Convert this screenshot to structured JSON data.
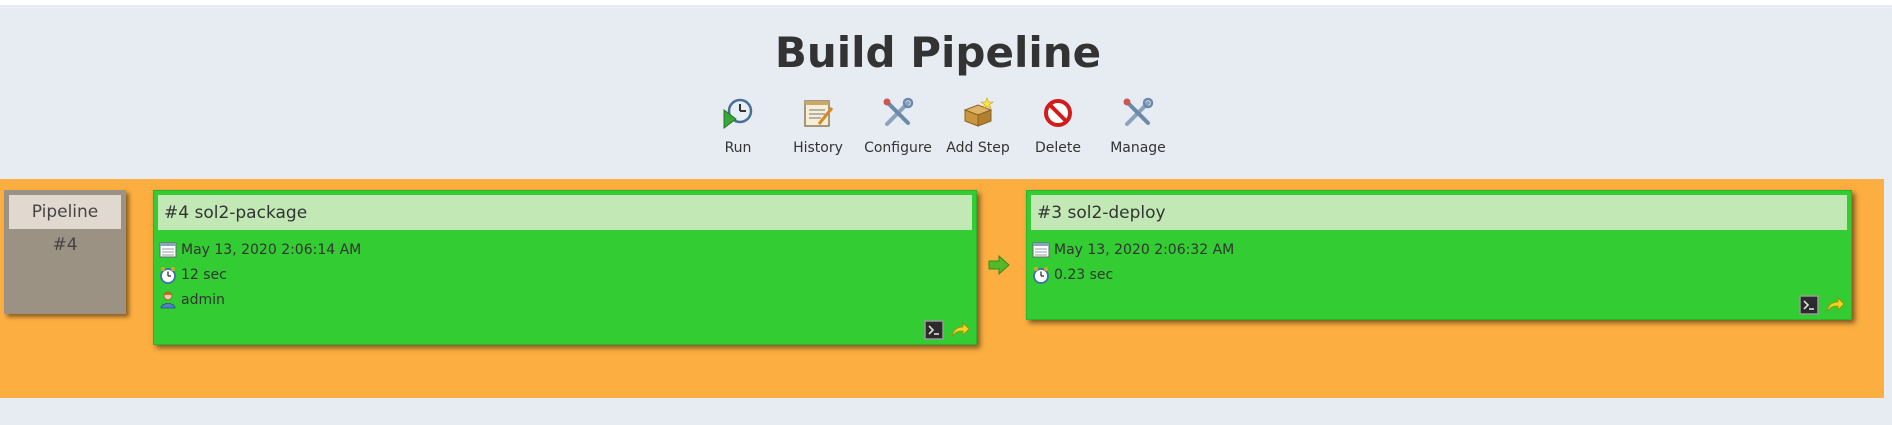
{
  "page": {
    "title": "Build Pipeline"
  },
  "toolbar": {
    "items": [
      {
        "label": "Run",
        "icon": "run-icon"
      },
      {
        "label": "History",
        "icon": "history-icon"
      },
      {
        "label": "Configure",
        "icon": "configure-icon"
      },
      {
        "label": "Add Step",
        "icon": "add-step-icon"
      },
      {
        "label": "Delete",
        "icon": "delete-icon"
      },
      {
        "label": "Manage",
        "icon": "manage-icon"
      }
    ]
  },
  "pipeline": {
    "label": "Pipeline",
    "number": "#4"
  },
  "builds": [
    {
      "title": "#4 sol2-package",
      "date": "May 13, 2020 2:06:14 AM",
      "duration": "12 sec",
      "user": "admin",
      "status_color": "#33cc33"
    },
    {
      "title": "#3 sol2-deploy",
      "date": "May 13, 2020 2:06:32 AM",
      "duration": "0.23 sec",
      "status_color": "#33cc33"
    }
  ],
  "colors": {
    "background": "#e7ecf3",
    "band": "#fcae40",
    "success": "#33cc33",
    "header_light": "#c1e8b5",
    "pipeline_box": "#9c9284"
  }
}
